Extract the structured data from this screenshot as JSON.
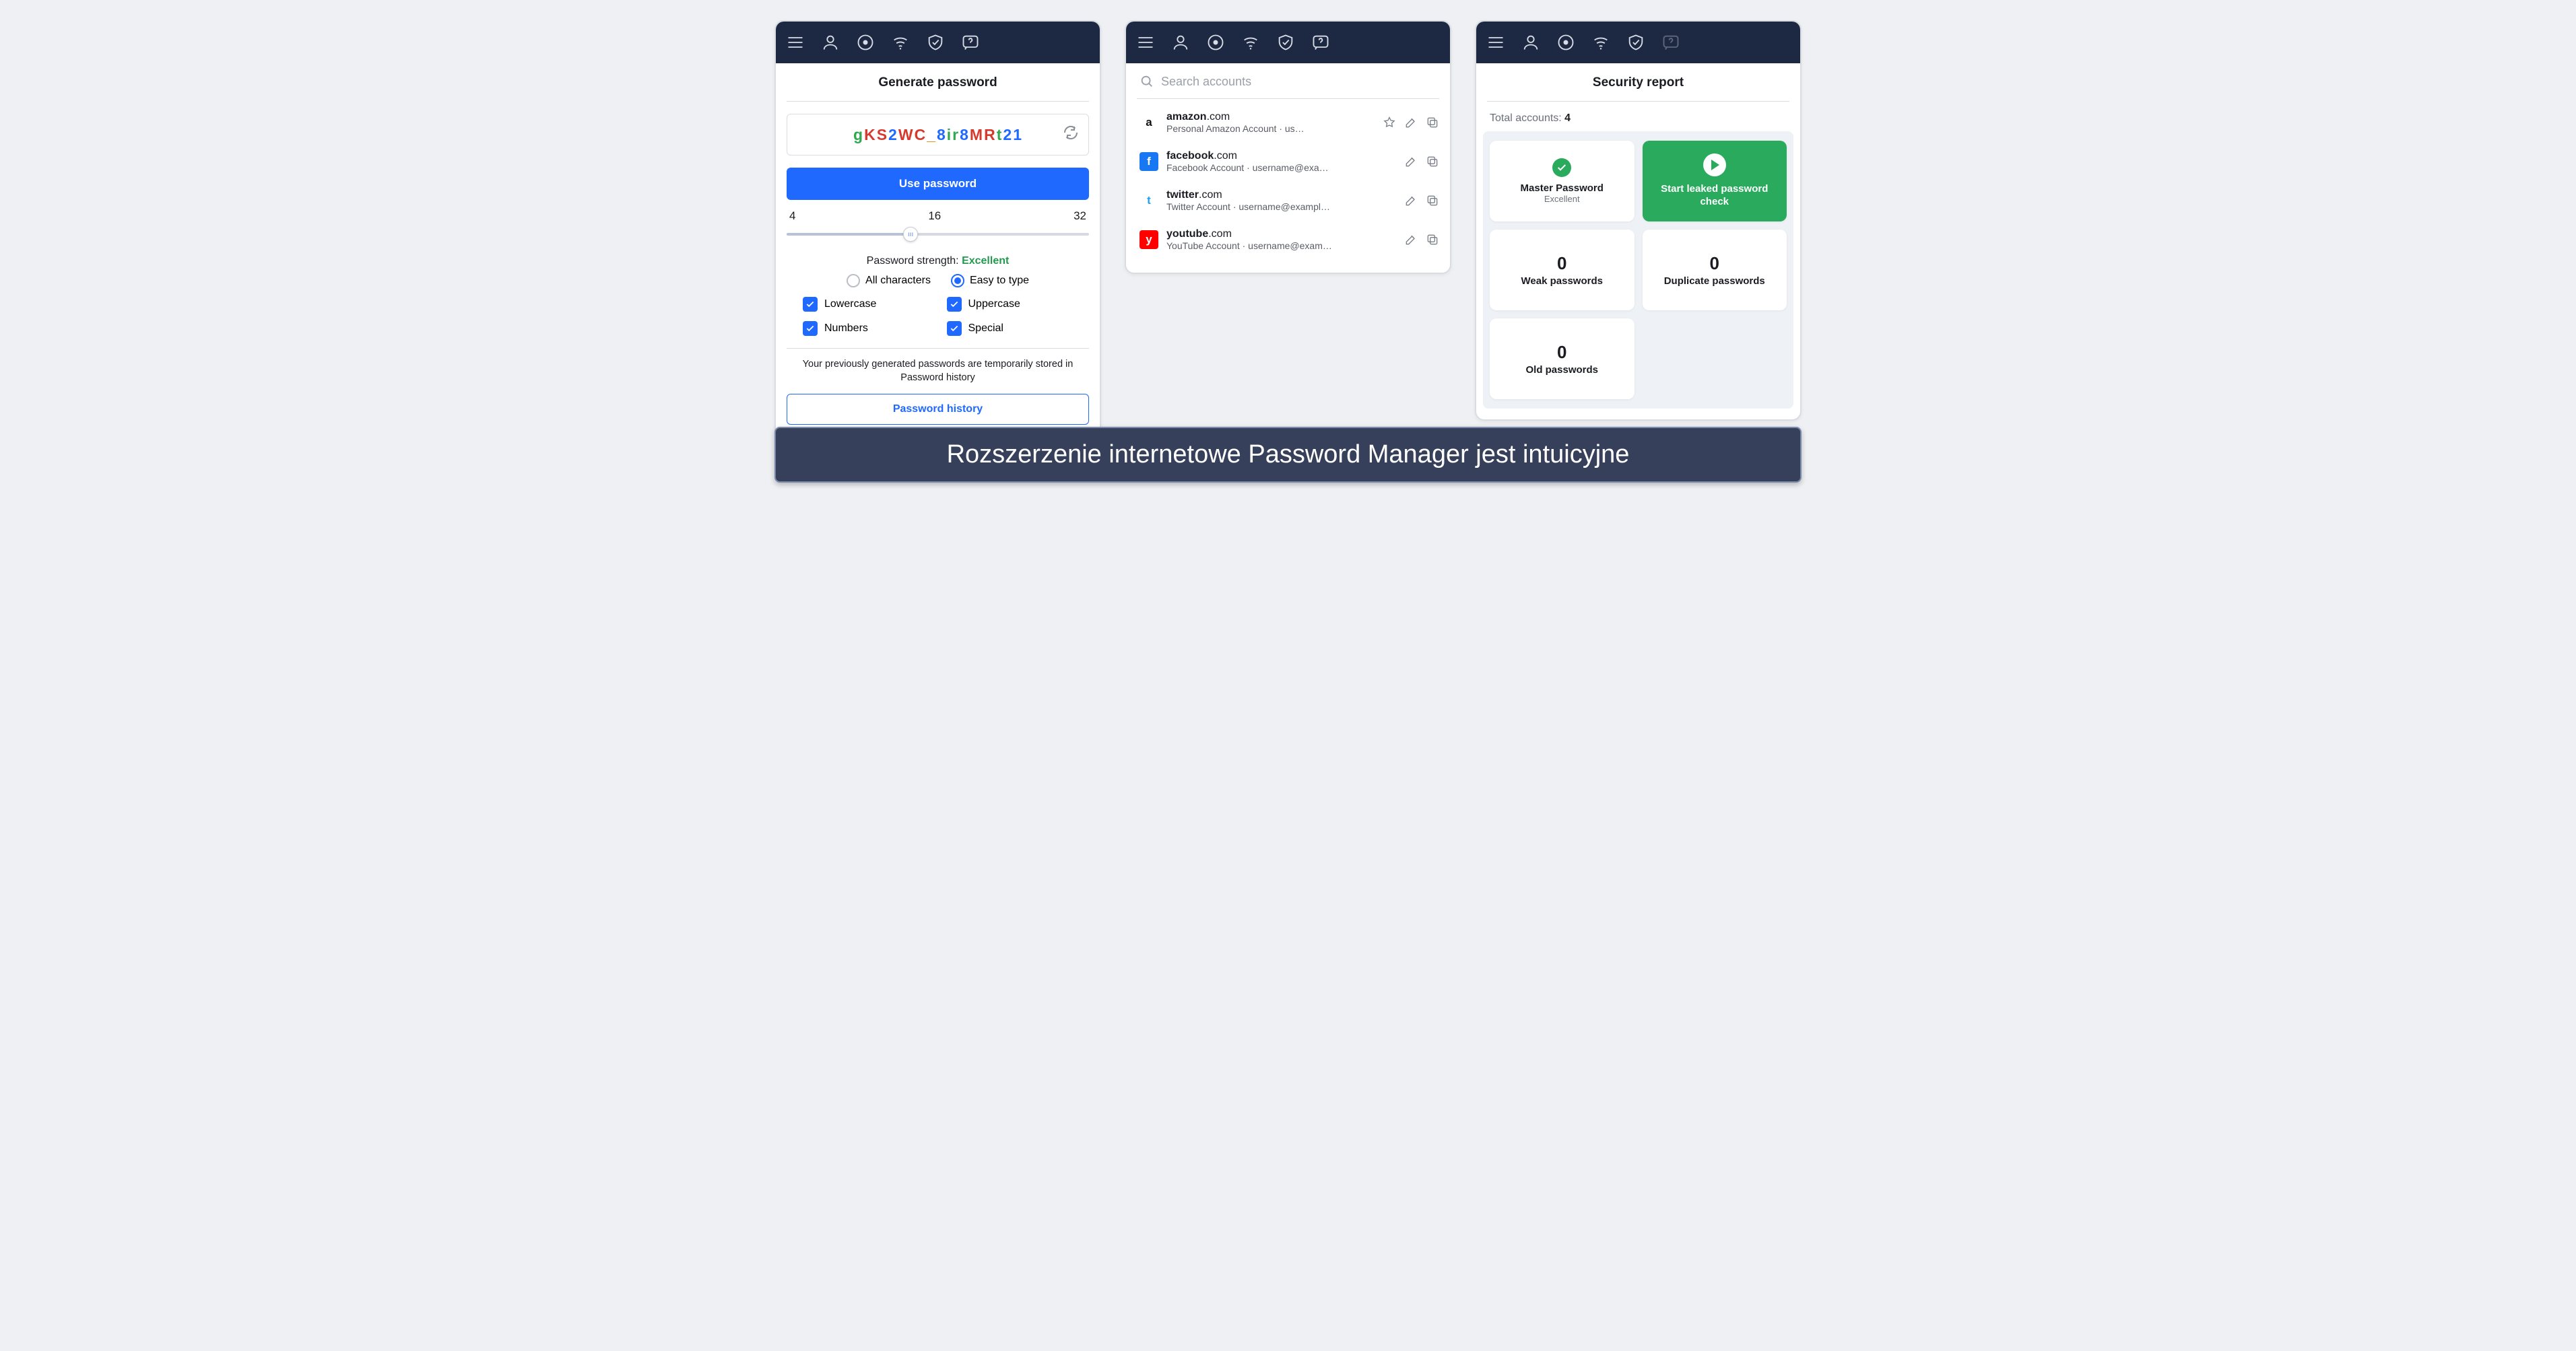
{
  "caption": "Rozszerzenie internetowe Password Manager jest intuicyjne",
  "topbar_icons": [
    "menu",
    "profile",
    "privacy",
    "wifi",
    "shield",
    "help"
  ],
  "screen1": {
    "title": "Generate password",
    "password_chars": [
      {
        "c": "g",
        "cls": "c-green"
      },
      {
        "c": "K",
        "cls": "c-red"
      },
      {
        "c": "S",
        "cls": "c-red"
      },
      {
        "c": "2",
        "cls": "c-blue"
      },
      {
        "c": "W",
        "cls": "c-red"
      },
      {
        "c": "C",
        "cls": "c-red"
      },
      {
        "c": "_",
        "cls": "c-orange"
      },
      {
        "c": "8",
        "cls": "c-blue"
      },
      {
        "c": "i",
        "cls": "c-green"
      },
      {
        "c": "r",
        "cls": "c-green"
      },
      {
        "c": "8",
        "cls": "c-blue"
      },
      {
        "c": "M",
        "cls": "c-red"
      },
      {
        "c": "R",
        "cls": "c-red"
      },
      {
        "c": "t",
        "cls": "c-green"
      },
      {
        "c": "2",
        "cls": "c-blue"
      },
      {
        "c": "1",
        "cls": "c-blue"
      }
    ],
    "use_btn": "Use password",
    "range": {
      "min": "4",
      "mid": "16",
      "max": "32"
    },
    "strength_label": "Password strength: ",
    "strength_value": "Excellent",
    "mode_all": "All characters",
    "mode_easy": "Easy to type",
    "opt_lower": "Lowercase",
    "opt_upper": "Uppercase",
    "opt_numbers": "Numbers",
    "opt_special": "Special",
    "history_note": "Your previously generated passwords are temporarily stored in Password history",
    "history_btn": "Password history"
  },
  "screen2": {
    "search_placeholder": "Search accounts",
    "accounts": [
      {
        "brand": "a",
        "brand_bg": "#ffffff",
        "brand_fg": "#111",
        "domain_bold": "amazon",
        "domain_rest": ".com",
        "sub": "Personal Amazon Account · us…",
        "star": true
      },
      {
        "brand": "f",
        "brand_bg": "#1877f2",
        "brand_fg": "#fff",
        "domain_bold": "facebook",
        "domain_rest": ".com",
        "sub": "Facebook Account · username@exa…",
        "star": false
      },
      {
        "brand": "t",
        "brand_bg": "#ffffff",
        "brand_fg": "#1da1f2",
        "domain_bold": "twitter",
        "domain_rest": ".com",
        "sub": "Twitter Account · username@exampl…",
        "star": false
      },
      {
        "brand": "y",
        "brand_bg": "#ff0000",
        "brand_fg": "#fff",
        "domain_bold": "youtube",
        "domain_rest": ".com",
        "sub": "YouTube Account · username@exam…",
        "star": false
      }
    ]
  },
  "screen3": {
    "title": "Security report",
    "total_label": "Total accounts: ",
    "total_value": "4",
    "master_title": "Master Password",
    "master_sub": "Excellent",
    "action_label": "Start leaked password check",
    "weak_count": "0",
    "weak_label": "Weak passwords",
    "dup_count": "0",
    "dup_label": "Duplicate passwords",
    "old_count": "0",
    "old_label": "Old passwords"
  }
}
